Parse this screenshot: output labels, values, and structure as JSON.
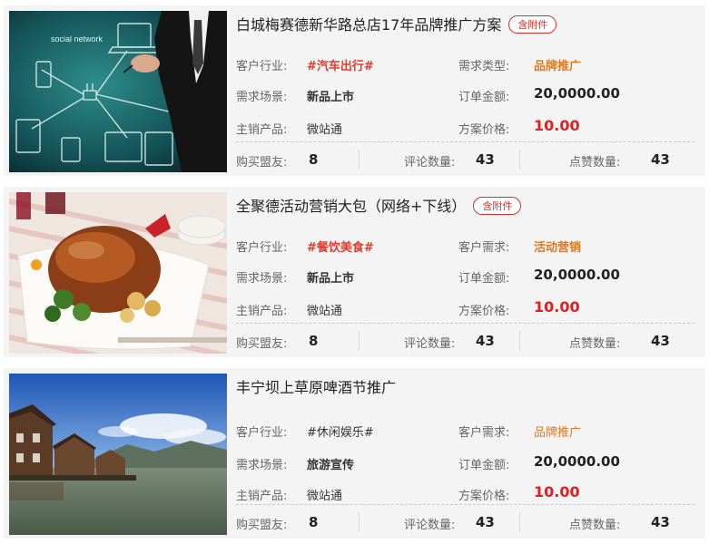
{
  "labels": {
    "industry": "客户行业:",
    "demand_type": "需求类型:",
    "client_need": "客户需求:",
    "scene": "需求场景:",
    "order_amount": "订单金额:",
    "product": "主销产品:",
    "plan_price": "方案价格:",
    "buyers": "购买盟友:",
    "comments": "评论数量:",
    "likes": "点赞数量:"
  },
  "cards": [
    {
      "title": "白城梅赛德新华路总店17年品牌推广方案",
      "badge": "含附件",
      "industry": "#汽车出行#",
      "need_label": "需求类型:",
      "need": "品牌推广",
      "scene": "新品上市",
      "order_amount": "20,0000.00",
      "product": "微站通",
      "price": "10.00",
      "buyers": "8",
      "comments": "43",
      "likes": "43",
      "image_text": "social network"
    },
    {
      "title": "全聚德活动营销大包（网络+下线）",
      "badge": "含附件",
      "industry": "#餐饮美食#",
      "need_label": "客户需求:",
      "need": "活动营销",
      "scene": "新品上市",
      "order_amount": "20,0000.00",
      "product": "微站通",
      "price": "10.00",
      "buyers": "8",
      "comments": "43",
      "likes": "43"
    },
    {
      "title": "丰宁坝上草原啤酒节推广",
      "industry": "#休闲娱乐#",
      "need_label": "客户需求:",
      "need": "品牌推广",
      "scene": "旅游宣传",
      "order_amount": "20,0000.00",
      "product": "微站通",
      "price": "10.00",
      "buyers": "8",
      "comments": "43",
      "likes": "43"
    }
  ],
  "colors": {
    "tag_red": "#e23b2e",
    "orange": "#e6771a",
    "price_red": "#e02020",
    "badge_red": "#d9312c"
  }
}
